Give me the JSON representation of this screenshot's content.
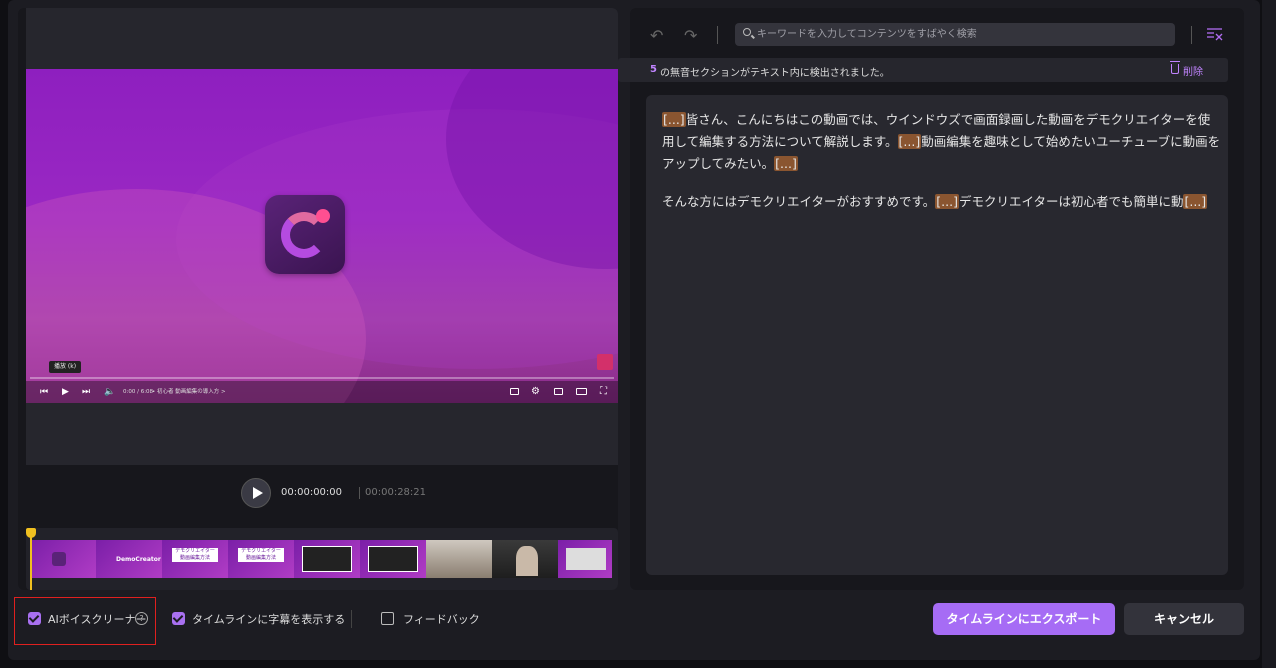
{
  "video_player": {
    "tooltip": "播放 (k)",
    "time_readout": "0:00 / 6:08",
    "chapter_text": "• 初心者 動画編集の導入方 >"
  },
  "playbar": {
    "current_time": "00:00:00:00",
    "total_time": "00:00:28:21"
  },
  "filmstrip": {
    "brand_label": "DemoCreator",
    "thumb_title_1": "デモクリエイター",
    "thumb_title_2": "動画編集方法"
  },
  "search": {
    "placeholder": "キーワードを入力してコンテンツをすばやく検索"
  },
  "notice": {
    "count": "5",
    "text": "の無音セクションがテキスト内に検出されました。",
    "delete_label": "削除"
  },
  "transcript": {
    "silence_marker": "[...]",
    "p1_seg1": "皆さん、こんにちはこの動画では、ウインドウズで画面録画した動画をデモクリエイターを使用して編集する方法について解説します。",
    "p1_seg2": "動画編集を趣味として始めたいユーチューブに動画をアップしてみたい。",
    "p2_seg1": "そんな方にはデモクリエイターがおすすめです。",
    "p2_seg2": "デモクリエイターは初心者でも簡単に動"
  },
  "bottom": {
    "ai_voice_cleaner_label": "AIボイスクリーナー",
    "help_glyph": "?",
    "show_subtitles_label": "タイムラインに字幕を表示する",
    "feedback_label": "フィードバック",
    "export_label": "タイムラインにエクスポート",
    "cancel_label": "キャンセル"
  },
  "colors": {
    "accent": "#a66cf5",
    "silence_marker_bg": "#8a5530",
    "highlight_border": "#e0201f",
    "playhead": "#f0c020"
  },
  "icons": [
    "undo-icon",
    "redo-icon",
    "search-icon",
    "clear-format-icon",
    "trash-icon",
    "play-icon",
    "help-icon",
    "feedback-icon",
    "checkbox-icon"
  ]
}
